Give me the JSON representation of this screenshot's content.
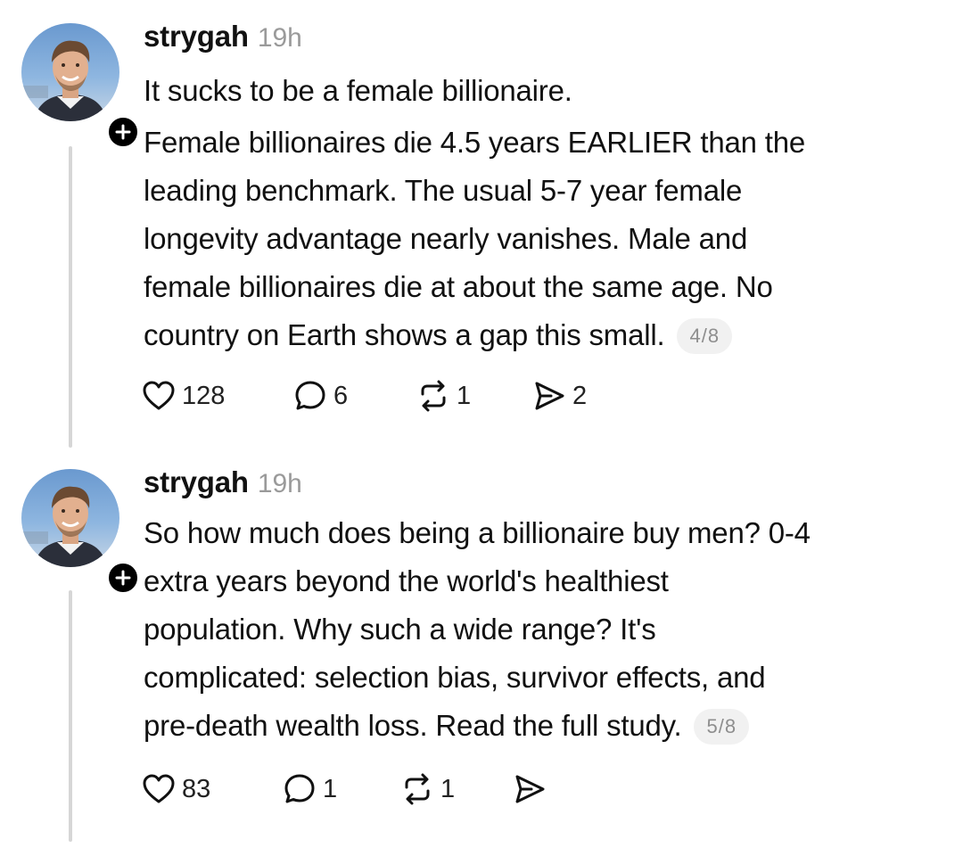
{
  "posts": [
    {
      "username": "strygah",
      "time": "19h",
      "avatar_icon": "user-avatar",
      "follow_icon": "plus-icon",
      "paragraphs": [
        "It sucks to be a female billionaire.",
        "Female billionaires die 4.5 years EARLIER than the",
        "leading benchmark. The usual 5-7 year female",
        "longevity advantage nearly vanishes. Male and",
        "female billionaires die at about the same age. No",
        "country on Earth shows a gap this small."
      ],
      "counter": "4/8",
      "actions": {
        "likes": "128",
        "replies": "6",
        "reposts": "1",
        "shares": "2"
      }
    },
    {
      "username": "strygah",
      "time": "19h",
      "avatar_icon": "user-avatar",
      "follow_icon": "plus-icon",
      "paragraphs": [
        "So how much does being a billionaire buy men? 0-4",
        "extra years beyond the world's healthiest",
        "population. Why such a wide range? It's",
        "complicated: selection bias, survivor effects, and",
        "pre-death wealth loss. Read the full study."
      ],
      "counter": "5/8",
      "actions": {
        "likes": "83",
        "replies": "1",
        "reposts": "1",
        "shares": ""
      }
    }
  ],
  "colors": {
    "text": "#111111",
    "muted": "#9a9a9a",
    "thread_line": "#d6d6d6",
    "counter_bg": "#f1f1f1",
    "badge": "#000000"
  }
}
